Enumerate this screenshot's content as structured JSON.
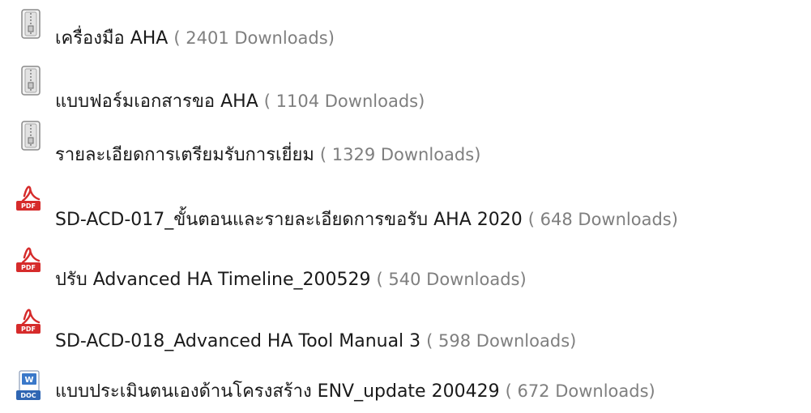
{
  "downloads": {
    "open_paren": "( ",
    "close_paren": ")",
    "items": [
      {
        "icon": "zip-archive-icon",
        "title": "เครื่องมือ AHA",
        "count_text": "2401 Downloads"
      },
      {
        "icon": "zip-archive-icon",
        "title": "แบบฟอร์มเอกสารขอ AHA",
        "count_text": "1104 Downloads"
      },
      {
        "icon": "zip-archive-icon",
        "title": "รายละเอียดการเตรียมรับการเยี่ยม",
        "count_text": "1329 Downloads"
      },
      {
        "icon": "pdf-file-icon",
        "title": "SD-ACD-017_ขั้นตอนและรายละเอียดการขอรับ AHA 2020",
        "count_text": "648 Downloads"
      },
      {
        "icon": "pdf-file-icon",
        "title": "ปรับ Advanced HA Timeline_200529",
        "count_text": "540 Downloads"
      },
      {
        "icon": "pdf-file-icon",
        "title": "SD-ACD-018_Advanced HA Tool Manual 3",
        "count_text": "598 Downloads"
      },
      {
        "icon": "doc-file-icon",
        "title": "แบบประเมินตนเองด้านโครงสร้าง ENV_update 200429",
        "count_text": "672 Downloads"
      }
    ]
  }
}
